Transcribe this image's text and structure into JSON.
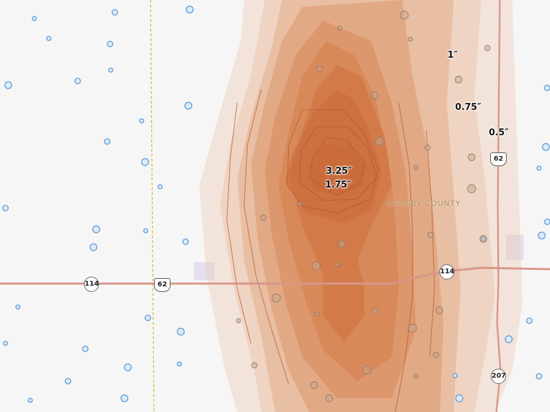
{
  "map": {
    "county_label": "CROSBY COUNTY",
    "contour_labels": [
      "1″",
      "0.75″",
      "0.5″",
      "3.25″",
      "1.75″"
    ],
    "route_shields": [
      {
        "type": "state",
        "number": "114"
      },
      {
        "type": "us",
        "number": "62"
      },
      {
        "type": "state",
        "number": "114"
      },
      {
        "type": "us",
        "number": "62"
      },
      {
        "type": "state",
        "number": "207"
      }
    ],
    "colors": {
      "background": "#f6f6f6",
      "shade_light": "#ecc2a6",
      "shade_mid": "#dc9466",
      "shade_dark": "#cd6f3c",
      "contour_line": "#b4572a",
      "road": "#d9968a",
      "county_line": "#d8c400",
      "water": "#5b9ad8"
    }
  }
}
